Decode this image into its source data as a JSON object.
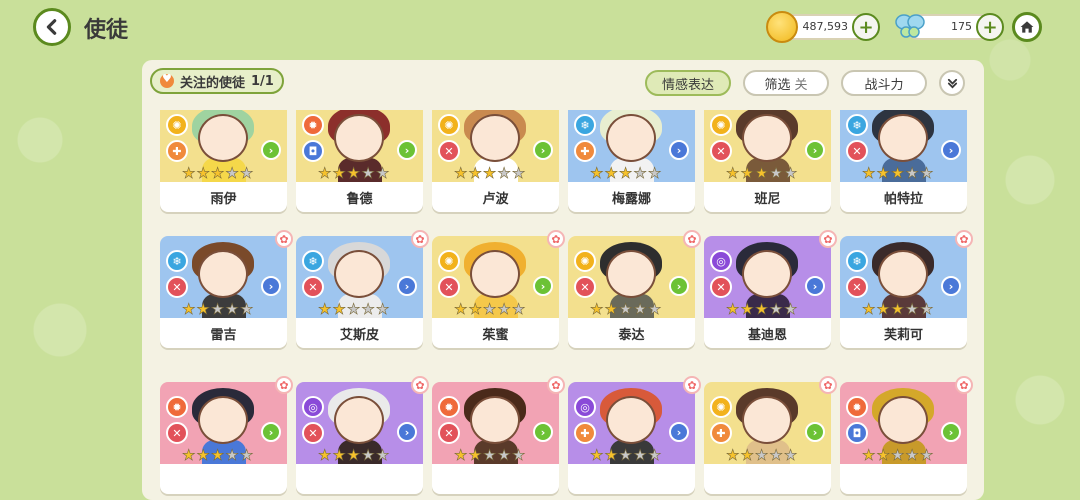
{
  "header": {
    "title": "使徒",
    "coins": "487,593",
    "butterflies": "175"
  },
  "toolbar": {
    "follow_label": "关注的使徒",
    "follow_count": "1/1",
    "emote_label": "情感表达",
    "filter_label": "筛选",
    "filter_state": "关",
    "power_label": "战斗力"
  },
  "colors": {
    "accent_green": "#5b8a1e",
    "element_fire": "#ef6a3a",
    "element_light": "#f2b21c",
    "element_ice": "#3aa6e0",
    "element_wind": "#6cc235",
    "element_dark": "#8a4ad8",
    "role_red": "#e2525a",
    "role_blue": "#4a78d8",
    "role_orange": "#f08a3c",
    "bg_yellow": "#f3e08e",
    "bg_blue": "#9ec5ef",
    "bg_purple": "#b78ee8",
    "bg_pink": "#f2a3b4"
  },
  "apostles": [
    {
      "name": "雨伊",
      "bg": "#f3e08e",
      "element": "light",
      "role": "heal",
      "stars": 3,
      "flower": false,
      "hair": "#9fd3a0",
      "body": "#f5d84a"
    },
    {
      "name": "鲁德",
      "bg": "#f3e08e",
      "element": "fire",
      "role": "shield",
      "stars": 3,
      "flower": false,
      "hair": "#8c2f2b",
      "body": "#5a2b2b"
    },
    {
      "name": "卢波",
      "bg": "#f3e08e",
      "element": "light",
      "role": "attack",
      "stars": 3,
      "flower": false,
      "hair": "#c98a4f",
      "body": "#ffffff"
    },
    {
      "name": "梅露娜",
      "bg": "#9ec5ef",
      "element": "ice",
      "role": "heal",
      "stars": 3,
      "flower": false,
      "hair": "#e8eed0",
      "body": "#f2f2f2"
    },
    {
      "name": "班尼",
      "bg": "#f3e08e",
      "element": "light",
      "role": "attack",
      "stars": 3,
      "flower": false,
      "hair": "#5a3b2b",
      "body": "#7a5a3a"
    },
    {
      "name": "帕特拉",
      "bg": "#9ec5ef",
      "element": "ice",
      "role": "attack",
      "stars": 3,
      "flower": false,
      "hair": "#2d3440",
      "body": "#4a6c9a"
    },
    {
      "name": "雷吉",
      "bg": "#9ec5ef",
      "element": "ice",
      "role": "attack",
      "stars": 2,
      "flower": true,
      "hair": "#7a4a2a",
      "body": "#3c3c3c"
    },
    {
      "name": "艾斯皮",
      "bg": "#9ec5ef",
      "element": "ice",
      "role": "attack",
      "stars": 2,
      "flower": true,
      "hair": "#d8d8d8",
      "body": "#ececec"
    },
    {
      "name": "茱蜜",
      "bg": "#f3e08e",
      "element": "light",
      "role": "attack",
      "stars": 2,
      "flower": true,
      "hair": "#f0b030",
      "body": "#f5c84a"
    },
    {
      "name": "泰达",
      "bg": "#f3e08e",
      "element": "light",
      "role": "attack",
      "stars": 2,
      "flower": true,
      "hair": "#2e2e2e",
      "body": "#6a6a5a"
    },
    {
      "name": "基迪恩",
      "bg": "#b78ee8",
      "element": "dark",
      "role": "attack",
      "stars": 3,
      "flower": true,
      "hair": "#2a2a3a",
      "body": "#3a2a4a"
    },
    {
      "name": "芙莉可",
      "bg": "#9ec5ef",
      "element": "ice",
      "role": "attack",
      "stars": 3,
      "flower": true,
      "hair": "#3a2a2a",
      "body": "#5a3a3a"
    },
    {
      "name": "",
      "bg": "#f2a3b4",
      "element": "fire",
      "role": "attack",
      "stars": 3,
      "flower": true,
      "hair": "#2a2a3a",
      "body": "#4a78d8"
    },
    {
      "name": "",
      "bg": "#b78ee8",
      "element": "dark",
      "role": "attack",
      "stars": 3,
      "flower": true,
      "hair": "#eaeaea",
      "body": "#3a2a2a"
    },
    {
      "name": "",
      "bg": "#f2a3b4",
      "element": "fire",
      "role": "attack",
      "stars": 2,
      "flower": true,
      "hair": "#4a2a1a",
      "body": "#5a3a2a"
    },
    {
      "name": "",
      "bg": "#b78ee8",
      "element": "dark",
      "role": "heal",
      "stars": 2,
      "flower": true,
      "hair": "#d85a3a",
      "body": "#3a3a3a"
    },
    {
      "name": "",
      "bg": "#f3e08e",
      "element": "light",
      "role": "heal",
      "stars": 2,
      "flower": true,
      "hair": "#5a3a2a",
      "body": "#e0c08a"
    },
    {
      "name": "",
      "bg": "#f2a3b4",
      "element": "fire",
      "role": "shield",
      "stars": 2,
      "flower": true,
      "hair": "#d4a82a",
      "body": "#c89a2a"
    }
  ]
}
